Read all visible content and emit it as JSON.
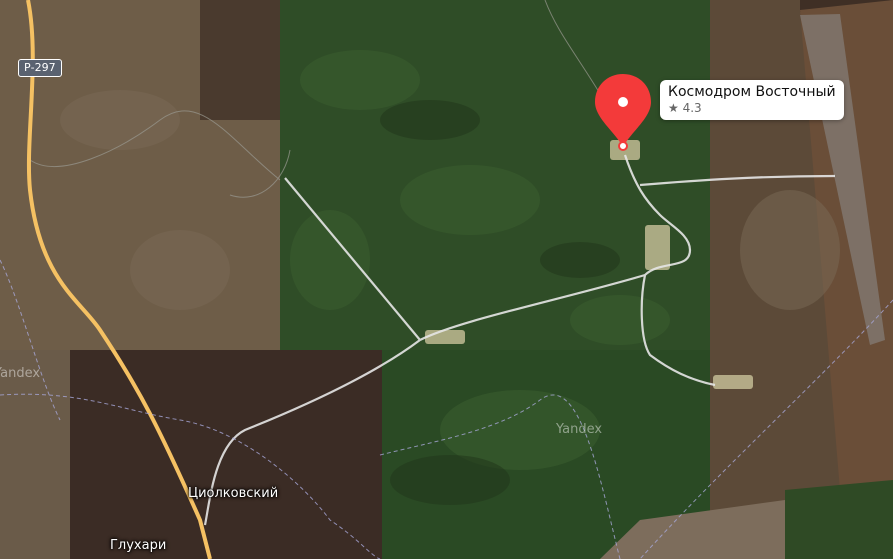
{
  "map": {
    "provider_watermark": "Yandex",
    "road_shield": "Р-297",
    "places": {
      "tsiolkovsky": "Циолковский",
      "glukhari": "Глухари"
    },
    "poi": {
      "name": "Космодром Восточный",
      "rating": "4.3",
      "star_icon": "star-icon",
      "pin_color": "#f33a3a"
    },
    "colors": {
      "forest": "#2f4a25",
      "steppe": "#6b5a45",
      "highway": "#f5c163"
    }
  }
}
